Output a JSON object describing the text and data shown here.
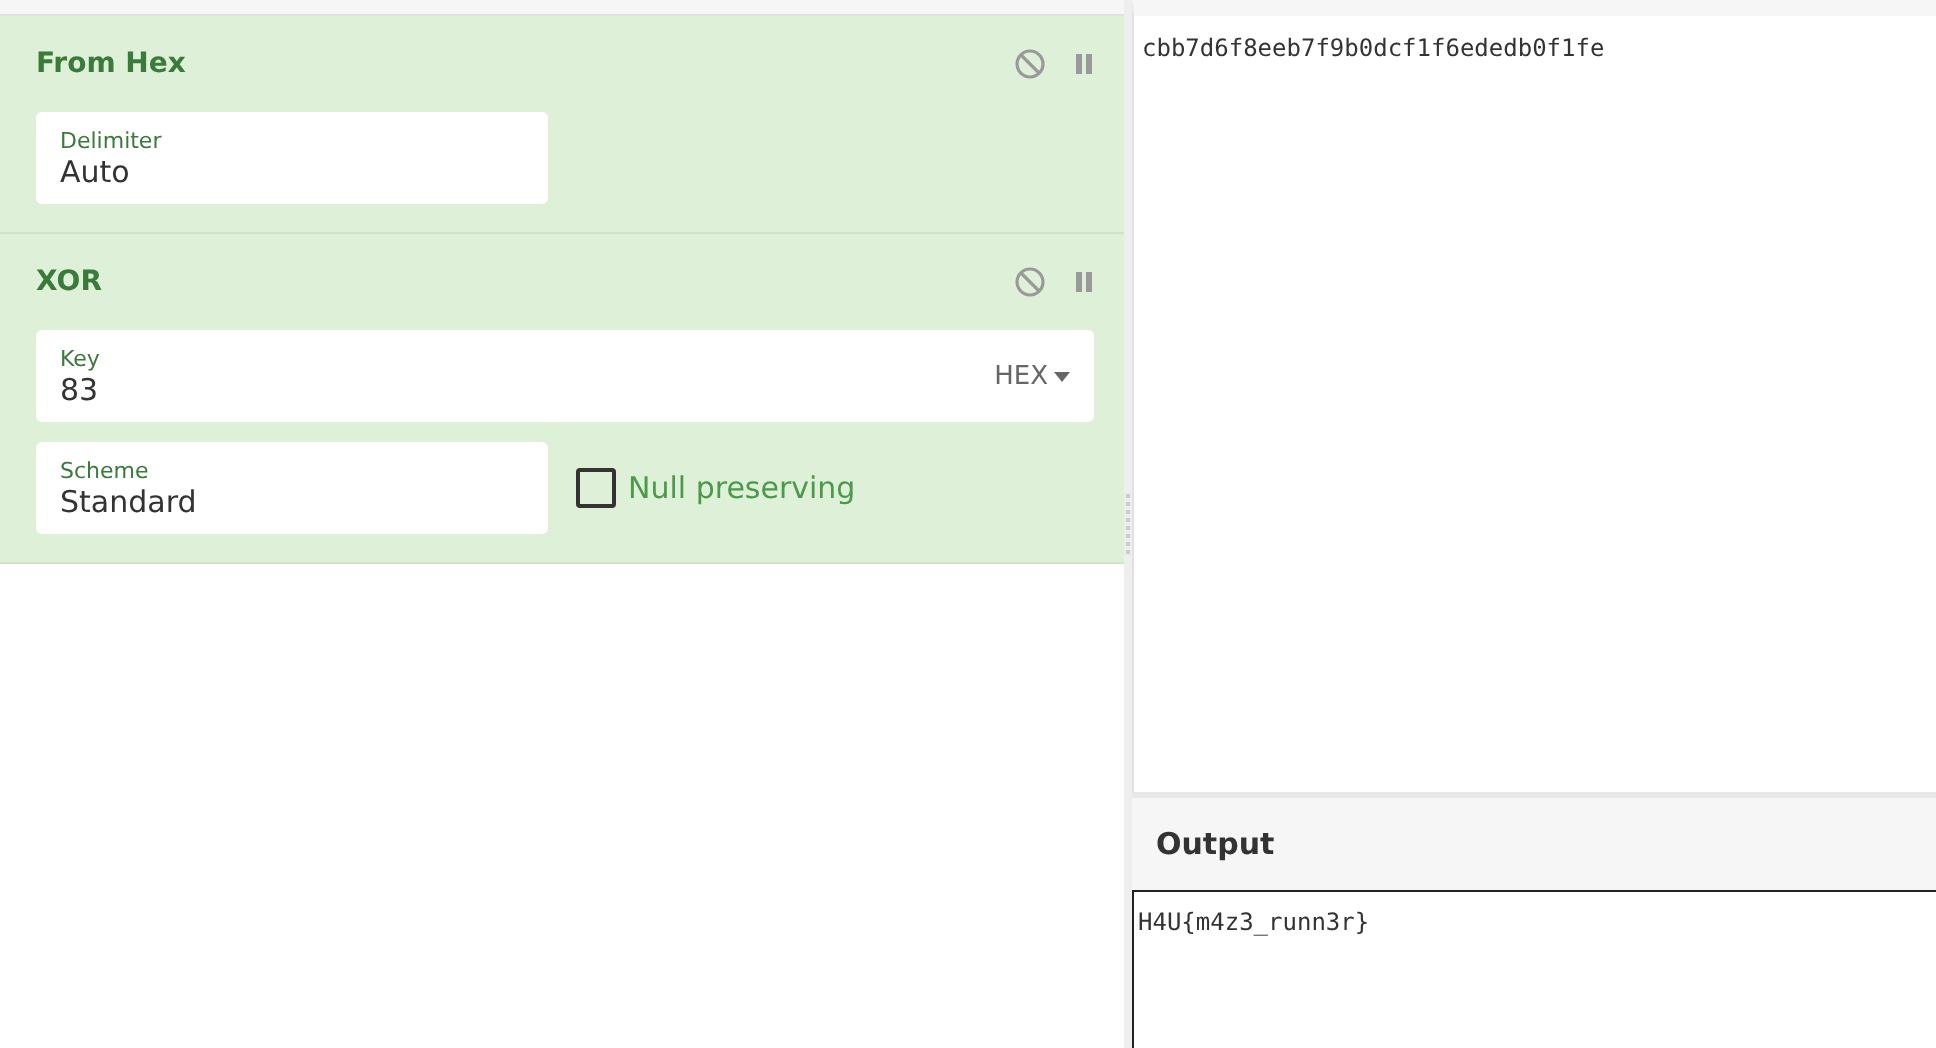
{
  "recipe": [
    {
      "name": "From Hex",
      "rows": [
        [
          {
            "kind": "text",
            "label": "Delimiter",
            "value": "Auto"
          }
        ]
      ]
    },
    {
      "name": "XOR",
      "rows": [
        [
          {
            "kind": "toggle",
            "label": "Key",
            "value": "83",
            "option": "HEX"
          }
        ],
        [
          {
            "kind": "text",
            "label": "Scheme",
            "value": "Standard"
          },
          {
            "kind": "checkbox",
            "label": "Null preserving",
            "checked": false
          }
        ]
      ]
    }
  ],
  "input": {
    "value": "cbb7d6f8eeb7f9b0dcf1f6ededb0f1fe"
  },
  "output": {
    "title": "Output",
    "value": "H4U{m4z3_runn3r}"
  }
}
